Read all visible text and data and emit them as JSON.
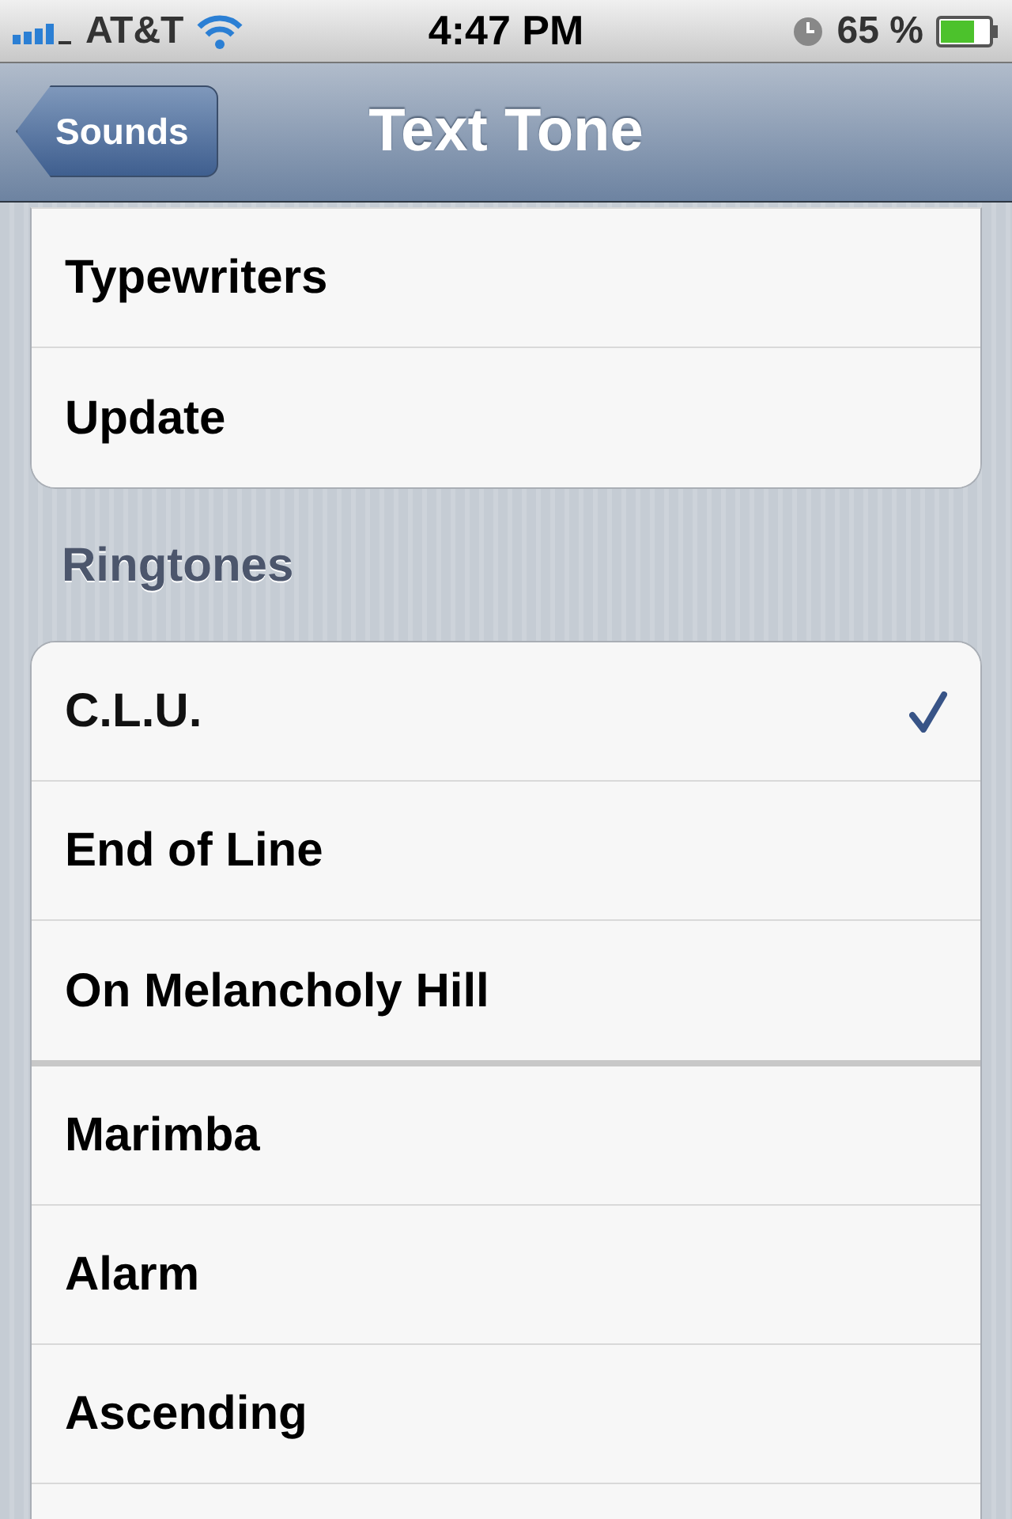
{
  "status_bar": {
    "carrier": "AT&T",
    "time": "4:47 PM",
    "battery": "65 %"
  },
  "nav_bar": {
    "back": "Sounds",
    "title": "Text Tone"
  },
  "alert_tones": [
    {
      "label": "Typewriters",
      "selected": false
    },
    {
      "label": "Update",
      "selected": false
    }
  ],
  "ringtones": {
    "header": "Ringtones",
    "parts": [
      [
        {
          "label": "C.L.U.",
          "selected": true
        },
        {
          "label": "End of Line",
          "selected": false
        },
        {
          "label": "On Melancholy Hill",
          "selected": false
        }
      ],
      [
        {
          "label": "Marimba",
          "selected": false
        },
        {
          "label": "Alarm",
          "selected": false
        },
        {
          "label": "Ascending",
          "selected": false
        }
      ]
    ]
  }
}
